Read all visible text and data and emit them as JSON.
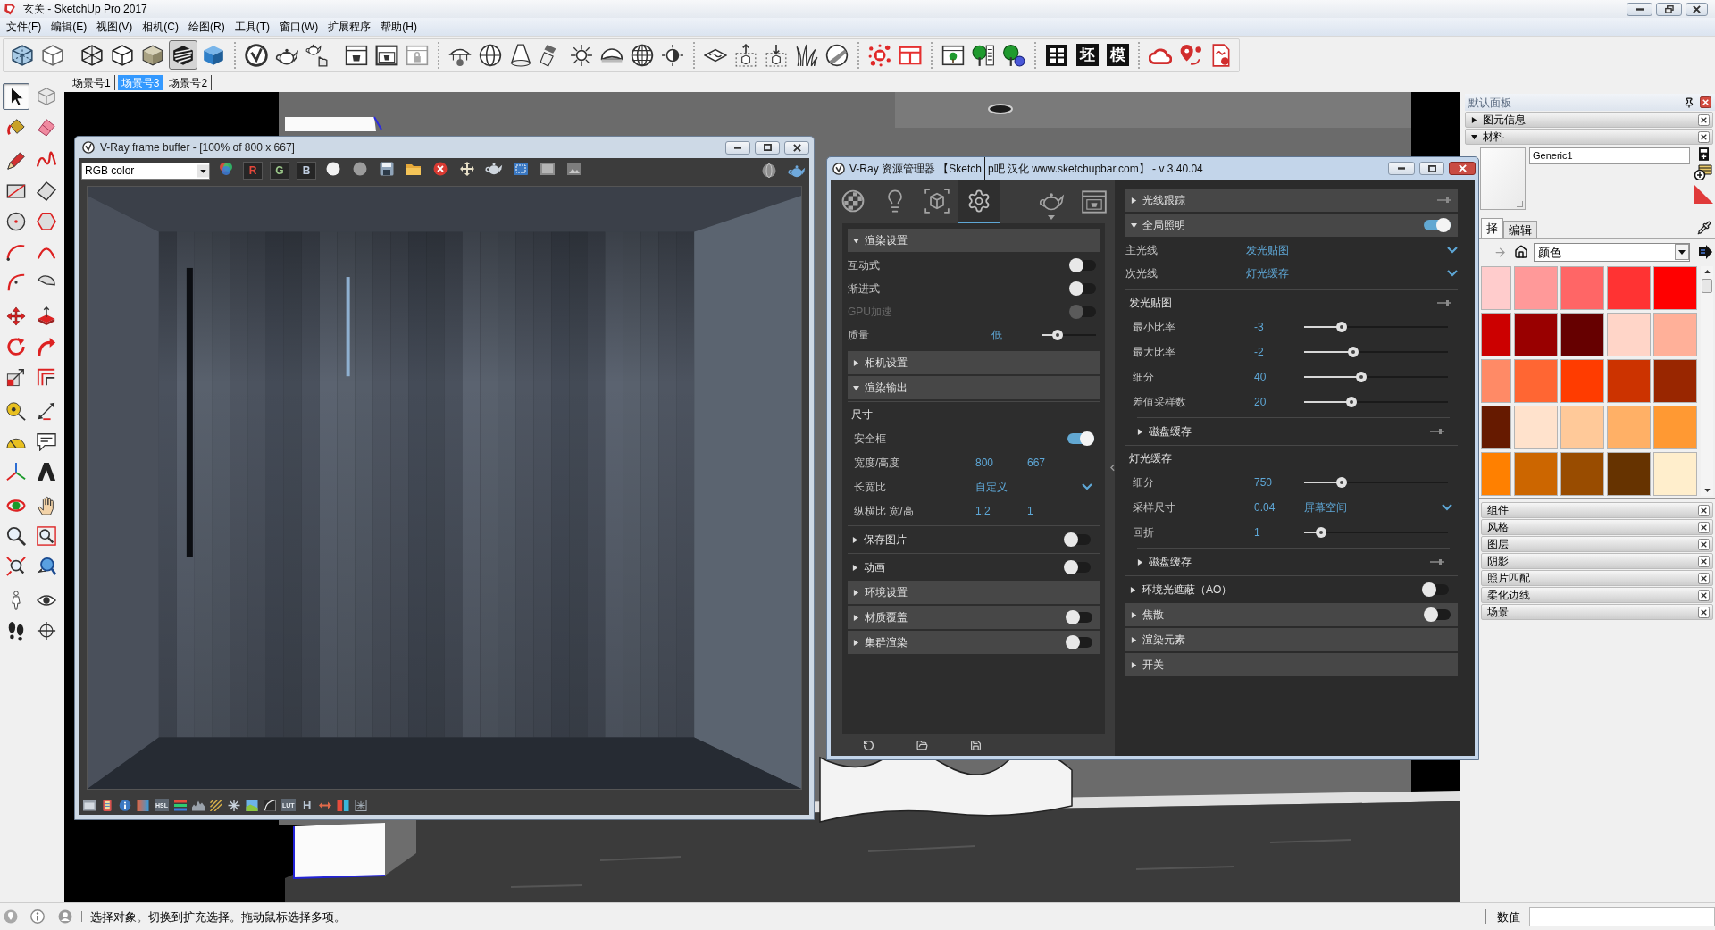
{
  "window": {
    "title": "玄关 - SketchUp Pro 2017"
  },
  "menu": [
    "文件(F)",
    "编辑(E)",
    "视图(V)",
    "相机(C)",
    "绘图(R)",
    "工具(T)",
    "窗口(W)",
    "扩展程序",
    "帮助(H)"
  ],
  "toolbar": {
    "style_buttons": [
      {
        "selected": false
      },
      {
        "selected": false
      },
      {
        "selected": false
      },
      {
        "selected": true
      },
      {
        "selected": false
      }
    ],
    "glyph_buttons": [
      "坯",
      "模"
    ]
  },
  "scene_tabs": [
    {
      "label": "场景号1",
      "selected": false
    },
    {
      "label": "场景号3",
      "selected": true
    },
    {
      "label": "场景号2",
      "selected": false
    }
  ],
  "tools": [
    {
      "selected": true
    },
    {
      "selected": false
    },
    {
      "selected": false
    },
    {
      "selected": false
    },
    {
      "selected": false
    },
    {
      "selected": false
    },
    {
      "selected": false
    },
    {
      "selected": false
    },
    {
      "selected": false
    },
    {
      "selected": false
    },
    {
      "selected": false
    },
    {
      "selected": false
    },
    {
      "selected": false
    },
    {
      "selected": false
    },
    {
      "selected": false
    },
    {
      "selected": false
    },
    {
      "selected": false
    },
    {
      "selected": false
    },
    {
      "selected": false
    },
    {
      "selected": false
    },
    {
      "selected": false
    },
    {
      "selected": false
    },
    {
      "selected": false
    },
    {
      "selected": false
    },
    {
      "selected": false
    },
    {
      "selected": false
    },
    {
      "selected": false
    },
    {
      "selected": false
    },
    {
      "selected": false
    },
    {
      "selected": false
    },
    {
      "selected": false
    },
    {
      "selected": false
    },
    {
      "selected": false
    },
    {
      "selected": false
    },
    {
      "selected": false
    },
    {
      "selected": false
    }
  ],
  "frame_buffer": {
    "title": "V-Ray frame buffer - [100% of 800 x 667]",
    "channel": "RGB color",
    "channel_buttons": [
      {
        "label": "R",
        "color": "#e5473a"
      },
      {
        "label": "G",
        "color": "#9cc98a"
      },
      {
        "label": "B",
        "color": "#bfcde0"
      }
    ],
    "footer_labels": [
      "HSL",
      "LUT",
      "H"
    ]
  },
  "asset_editor": {
    "title": [
      "V-Ray 资源管理器 【Sketch",
      "p吧 汉化 www.sketchupbar.com】 - v 3.40.04"
    ],
    "tabs": [
      {
        "selected": false
      },
      {
        "selected": false
      },
      {
        "selected": false
      },
      {
        "selected": true
      }
    ],
    "left_panel": {
      "sections": [
        {
          "kind": "rollout",
          "title": "渲染设置",
          "expanded": true,
          "rows": [
            {
              "kind": "toggle",
              "label": "互动式",
              "on": false,
              "disabled": false
            },
            {
              "kind": "toggle",
              "label": "渐进式",
              "on": false,
              "disabled": false
            },
            {
              "kind": "toggle",
              "label": "GPU加速",
              "on": false,
              "disabled": true
            },
            {
              "kind": "slider",
              "label": "质量",
              "value": "低",
              "level": 0.3
            }
          ]
        },
        {
          "kind": "rollout",
          "title": "相机设置",
          "expanded": false
        },
        {
          "kind": "rollout",
          "title": "渲染输出",
          "expanded": true,
          "children": [
            {
              "kind": "group",
              "title": "尺寸",
              "rows": [
                {
                  "kind": "toggle",
                  "label": "安全框",
                  "on": true,
                  "disabled": false
                },
                {
                  "kind": "pair",
                  "label": "宽度/高度",
                  "value": "800",
                  "value_2": "667"
                },
                {
                  "kind": "dropdown",
                  "label": "长宽比",
                  "value": "自定义"
                },
                {
                  "kind": "pair",
                  "label": "纵横比 宽/高",
                  "value": "1.2",
                  "value_2": "1"
                }
              ]
            },
            {
              "kind": "toggle_rollout",
              "title": "保存图片",
              "expanded": false,
              "on": false
            },
            {
              "kind": "toggle_rollout",
              "title": "动画",
              "expanded": false,
              "on": false
            }
          ]
        },
        {
          "kind": "rollout",
          "title": "环境设置",
          "expanded": false
        },
        {
          "kind": "toggle_rollout",
          "title": "材质覆盖",
          "expanded": false,
          "on": false
        },
        {
          "kind": "toggle_rollout",
          "title": "集群渲染",
          "expanded": false,
          "on": false
        }
      ]
    },
    "right_panel": {
      "sections": [
        {
          "kind": "pin_rollout",
          "title": "光线跟踪",
          "expanded": false
        },
        {
          "kind": "toggle_rollout",
          "title": "全局照明",
          "expanded": true,
          "on": true,
          "rows": [
            {
              "kind": "dropdown",
              "label": "主光线",
              "value": "发光贴图"
            },
            {
              "kind": "dropdown",
              "label": "次光线",
              "value": "灯光缓存"
            }
          ],
          "children": [
            {
              "kind": "pin_group",
              "title": "发光贴图",
              "rows": [
                {
                  "kind": "slider",
                  "label": "最小比率",
                  "value": "-3",
                  "level": 0.26
                },
                {
                  "kind": "slider",
                  "label": "最大比率",
                  "value": "-2",
                  "level": 0.34
                },
                {
                  "kind": "slider",
                  "label": "细分",
                  "value": "40",
                  "level": 0.4
                },
                {
                  "kind": "slider",
                  "label": "差值采样数",
                  "value": "20",
                  "level": 0.33
                }
              ],
              "children": [
                {
                  "kind": "pin_rollout",
                  "title": "磁盘缓存",
                  "expanded": false
                }
              ]
            },
            {
              "kind": "group",
              "title": "灯光缓存",
              "rows": [
                {
                  "kind": "slider",
                  "label": "细分",
                  "value": "750",
                  "level": 0.26
                },
                {
                  "kind": "value_dropdown",
                  "label": "采样尺寸",
                  "value": "0.04",
                  "option": "屏幕空间"
                },
                {
                  "kind": "slider",
                  "label": "回折",
                  "value": "1",
                  "level": 0.12
                }
              ],
              "children": [
                {
                  "kind": "pin_rollout",
                  "title": "磁盘缓存",
                  "expanded": false
                }
              ]
            },
            {
              "kind": "toggle_rollout",
              "title": "环境光遮蔽（AO）",
              "expanded": false,
              "on": false
            }
          ]
        },
        {
          "kind": "toggle_rollout",
          "title": "焦散",
          "expanded": false,
          "on": false
        },
        {
          "kind": "rollout",
          "title": "渲染元素",
          "expanded": false
        },
        {
          "kind": "rollout",
          "title": "开关",
          "expanded": false
        }
      ]
    }
  },
  "tray": {
    "title": "默认面板",
    "panels": [
      {
        "title": "图元信息",
        "expanded": false
      },
      {
        "title": "材料",
        "expanded": true
      }
    ],
    "material": {
      "name": "Generic1",
      "tabs": [
        {
          "label": "择",
          "selected": true
        },
        {
          "label": "编辑",
          "selected": false
        }
      ],
      "library": "颜色",
      "swatches": [
        {
          "color": "#ffcccc"
        },
        {
          "color": "#ff9999"
        },
        {
          "color": "#ff6666"
        },
        {
          "color": "#ff3333"
        },
        {
          "color": "#ff0000"
        },
        {
          "color": "#cc0000"
        },
        {
          "color": "#990000"
        },
        {
          "color": "#660000"
        },
        {
          "color": "#ffd5c8"
        },
        {
          "color": "#ffb099"
        },
        {
          "color": "#ff8a66"
        },
        {
          "color": "#ff6633"
        },
        {
          "color": "#ff3c00"
        },
        {
          "color": "#cc3300"
        },
        {
          "color": "#992600"
        },
        {
          "color": "#661a00"
        },
        {
          "color": "#ffe2cc"
        },
        {
          "color": "#ffc999"
        },
        {
          "color": "#ffb066"
        },
        {
          "color": "#ff9933"
        },
        {
          "color": "#ff8000"
        },
        {
          "color": "#cc6600"
        },
        {
          "color": "#994c00"
        },
        {
          "color": "#663300"
        },
        {
          "color": "#ffeecc"
        }
      ]
    },
    "more_panels": [
      "组件",
      "风格",
      "图层",
      "阴影",
      "照片匹配",
      "柔化边线",
      "场景"
    ]
  },
  "status_bar": {
    "hint": "选择对象。切换到扩充选择。拖动鼠标选择多项。",
    "measurements_label": "数值"
  }
}
